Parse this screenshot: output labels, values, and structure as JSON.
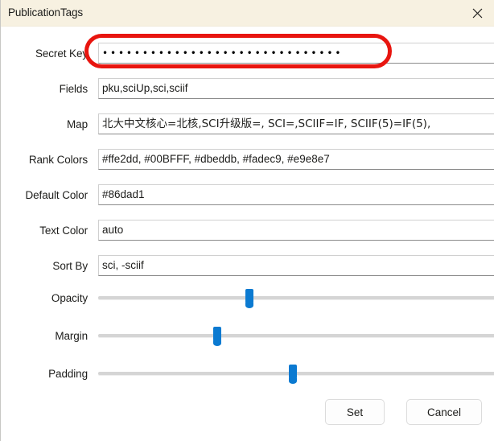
{
  "window": {
    "title": "PublicationTags",
    "close_icon": "close-icon",
    "titlebar_color": "#f7f1e1"
  },
  "annotation": {
    "shape": "rounded-rectangle-highlight",
    "color": "#e8150f",
    "target": "secret-key-field"
  },
  "form": {
    "rows": [
      {
        "label": "Secret Key",
        "type": "password",
        "value": "••••••••••••••••••••••••••••••",
        "placeholder": ""
      },
      {
        "label": "Fields",
        "type": "text",
        "value": "pku,sciUp,sci,sciif",
        "placeholder": ""
      },
      {
        "label": "Map",
        "type": "text-cjk",
        "value": "北大中文核心=北核,SCI升级版=, SCI=,SCIIF=IF, SCIIF(5)=IF(5),",
        "placeholder": ""
      },
      {
        "label": "Rank Colors",
        "type": "text",
        "value": "#ffe2dd, #00BFFF, #dbeddb, #fadec9, #e9e8e7",
        "placeholder": ""
      },
      {
        "label": "Default Color",
        "type": "text",
        "value": "#86dad1",
        "placeholder": ""
      },
      {
        "label": "Text Color",
        "type": "text",
        "value": "auto",
        "placeholder": ""
      },
      {
        "label": "Sort By",
        "type": "text",
        "value": "sci, -sciif",
        "placeholder": ""
      }
    ],
    "sliders": [
      {
        "label": "Opacity",
        "percent": 38,
        "thumb_color": "#0b7ad1"
      },
      {
        "label": "Margin",
        "percent": 30,
        "thumb_color": "#0b7ad1"
      },
      {
        "label": "Padding",
        "percent": 49,
        "thumb_color": "#0b7ad1"
      }
    ]
  },
  "footer": {
    "set_label": "Set",
    "cancel_label": "Cancel"
  }
}
